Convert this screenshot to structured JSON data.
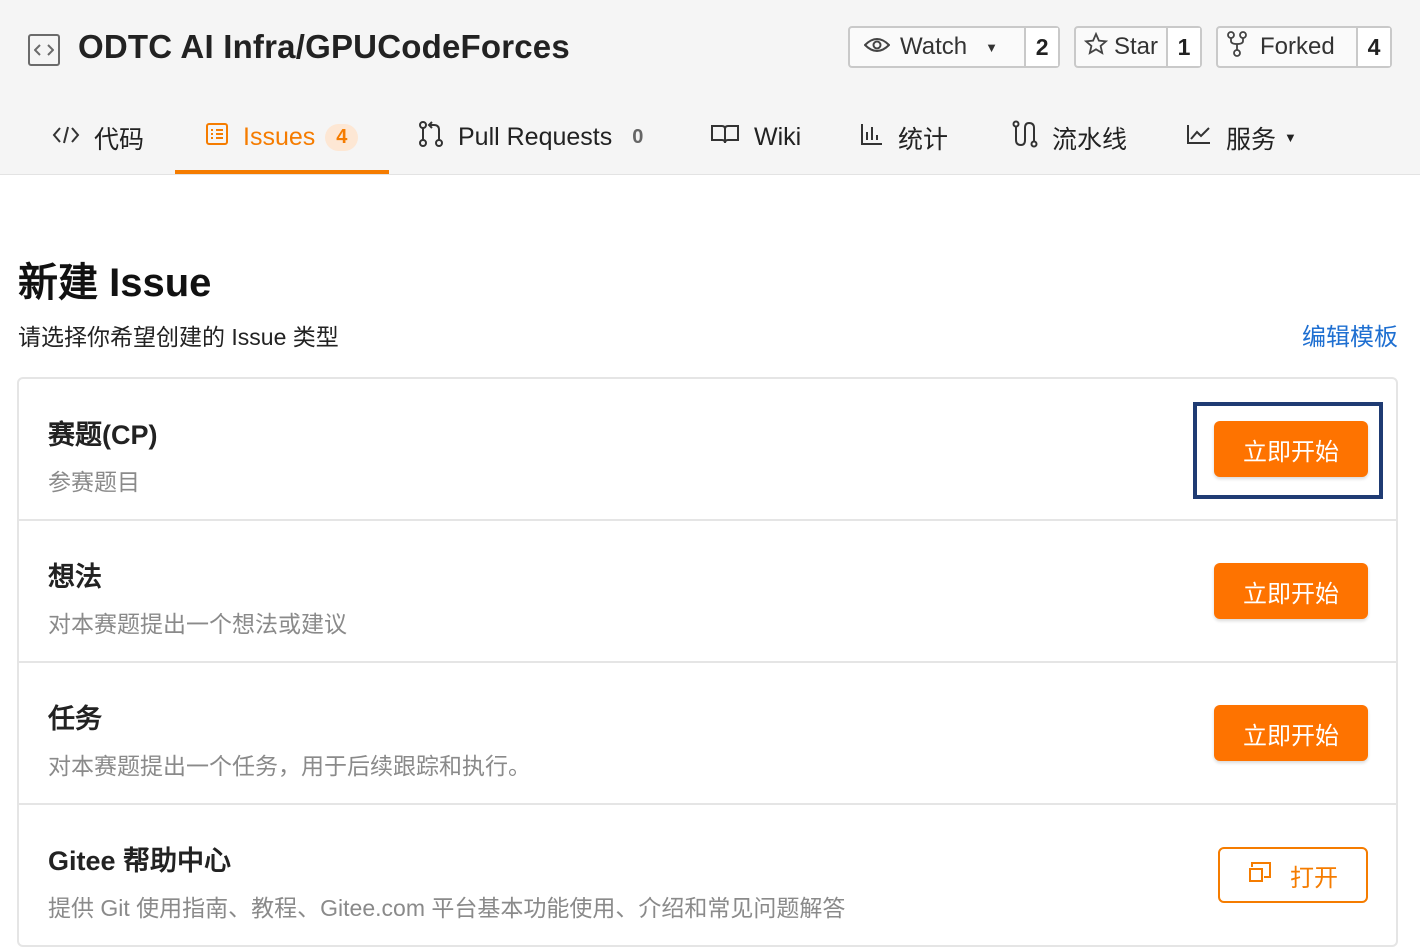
{
  "repo": {
    "title": "ODTC AI Infra/GPUCodeForces"
  },
  "actions": {
    "watch": {
      "label": "Watch",
      "count": "2"
    },
    "star": {
      "label": "Star",
      "count": "1"
    },
    "forked": {
      "label": "Forked",
      "count": "4"
    }
  },
  "tabs": [
    {
      "label": "代码"
    },
    {
      "label": "Issues",
      "badge": "4",
      "active": true
    },
    {
      "label": "Pull Requests",
      "badge": "0"
    },
    {
      "label": "Wiki"
    },
    {
      "label": "统计"
    },
    {
      "label": "流水线"
    },
    {
      "label": "服务"
    }
  ],
  "page": {
    "title": "新建 Issue",
    "subtitle": "请选择你希望创建的 Issue 类型",
    "edit_template": "编辑模板"
  },
  "issue_types": [
    {
      "title": "赛题(CP)",
      "desc": "参赛题目",
      "button": "立即开始"
    },
    {
      "title": "想法",
      "desc": "对本赛题提出一个想法或建议",
      "button": "立即开始"
    },
    {
      "title": "任务",
      "desc": "对本赛题提出一个任务，用于后续跟踪和执行。",
      "button": "立即开始"
    },
    {
      "title": "Gitee 帮助中心",
      "desc": "提供 Git 使用指南、教程、Gitee.com 平台基本功能使用、介绍和常见问题解答",
      "button": "打开"
    }
  ],
  "colors": {
    "accent": "#fe7300",
    "link": "#1e6fd1",
    "focus": "#1f3b73"
  }
}
